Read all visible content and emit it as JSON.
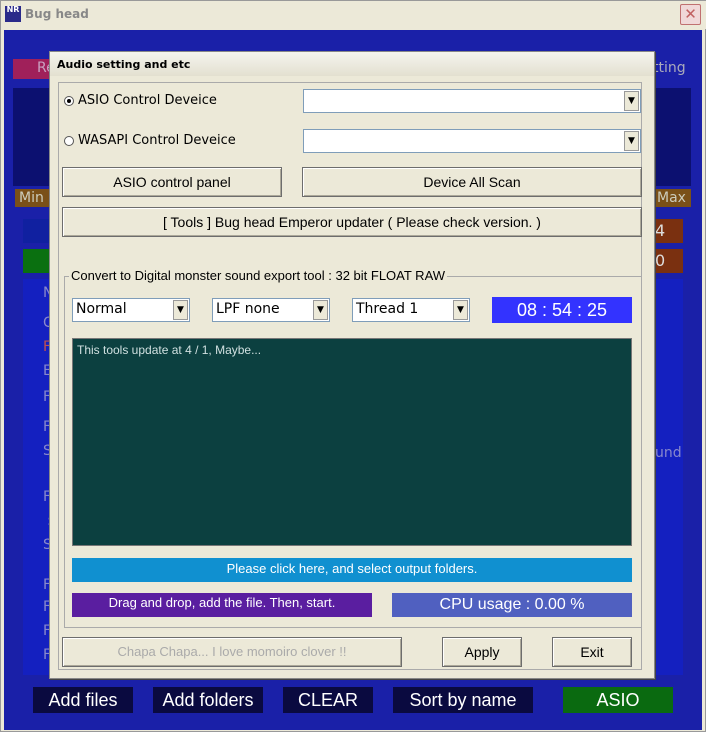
{
  "outer_window": {
    "icon_text": "NR",
    "title": "Bug head",
    "close_label": "✕"
  },
  "background": {
    "top_left_label": "Re",
    "top_right_label": "tting",
    "min_label": "Min",
    "max_label": "Max",
    "right_digit_1": "4",
    "right_digit_2": "0",
    "right_word": "und",
    "left_letters": [
      "N",
      "C",
      "F",
      "E",
      "F",
      "F",
      "S",
      "F",
      ":",
      "S",
      "F",
      "F",
      "F",
      "F"
    ],
    "buttons": [
      "Add files",
      "Add folders",
      "CLEAR",
      "Sort by name",
      "ASIO"
    ],
    "colors": {
      "bg": "#1a20a8",
      "asio_button": "#0a6a10",
      "red_tab": "#a0205a"
    }
  },
  "dialog": {
    "title": "Audio setting and etc",
    "asio_radio_label": "ASIO Control Deveice",
    "asio_selected": true,
    "wasapi_radio_label": "WASAPI Control Deveice",
    "wasapi_selected": false,
    "asio_device_value": "",
    "wasapi_device_value": "",
    "asio_panel_button": "ASIO control panel",
    "scan_button": "Device All Scan",
    "updater_button": "[ Tools ]  Bug head Emperor updater ( Please check version. )",
    "group_label": "Convert to Digital monster sound export tool : 32 bit FLOAT RAW",
    "mode_value": "Normal",
    "lpf_value": "LPF none",
    "thread_value": "Thread 1",
    "clock": "08 : 54 : 25",
    "log_text": "This tools update at 4 / 1, Maybe...",
    "output_bar": "Please click here, and select output folders.",
    "drag_bar": "Drag and drop, add the file. Then, start.",
    "cpu_bar": "CPU usage : 0.00 %",
    "chapa_button": "Chapa Chapa... I love momoiro clover !!",
    "apply_button": "Apply",
    "exit_button": "Exit"
  },
  "colors": {
    "clock_bg": "#3333ff",
    "log_bg": "#0c4040",
    "output_bar_bg": "#1090d0",
    "drag_bar_bg": "#5a1ea0",
    "cpu_bar_bg": "#5060c0"
  }
}
